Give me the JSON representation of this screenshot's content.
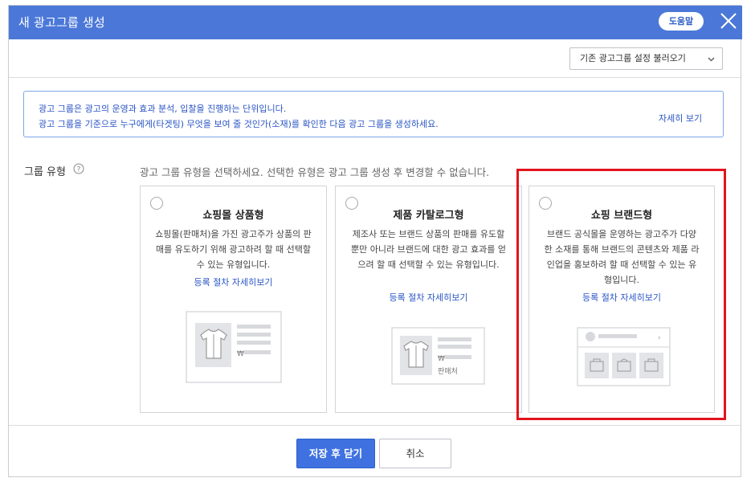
{
  "dialog": {
    "title": "새 광고그룹 생성",
    "help_label": "도움말"
  },
  "toolbar": {
    "load_settings_label": "기존 광고그룹 설정 불러오기"
  },
  "info": {
    "line1": "광고 그룹은 광고의 운영과 효과 분석, 입찰을 진행하는 단위입니다.",
    "line2": "광고 그룹을 기준으로 누구에게(타겟팅) 무엇을 보여 줄 것인가(소재)를 확인한 다음 광고 그룹을 생성하세요.",
    "detail_link": "자세히 보기"
  },
  "group_type": {
    "label": "그룹 유형",
    "description": "광고 그룹 유형을 선택하세요. 선택한 유형은 광고 그룹 생성 후 변경할 수 없습니다.",
    "cards": [
      {
        "title": "쇼핑몰 상품형",
        "description": "쇼핑몰(판매처)을 가진 광고주가 상품의 판매를 유도하기 위해 광고하려 할 때 선택할 수 있는 유형입니다.",
        "link": "등록 절차 자세히보기",
        "illus_price": "₩"
      },
      {
        "title": "제품 카탈로그형",
        "description": "제조사 또는 브랜드 상품의 판매를 유도할 뿐만 아니라 브랜드에 대한 광고 효과를 얻으려 할 때 선택할 수 있는 유형입니다.",
        "link": "등록 절차 자세히보기",
        "illus_price": "₩",
        "illus_seller": "판매처"
      },
      {
        "title": "쇼핑 브랜드형",
        "description": "브랜드 공식몰을 운영하는 광고주가 다양한 소재를 통해 브랜드의 콘텐츠와 제품 라인업을 홍보하려 할 때 선택할 수 있는 유형입니다.",
        "link": "등록 절차 자세히보기"
      }
    ]
  },
  "footer": {
    "save_close_label": "저장 후 닫기",
    "cancel_label": "취소"
  },
  "colors": {
    "title_bar": "#4b78d8",
    "link_blue": "#2a55c4",
    "primary_button": "#3f72e0",
    "highlight_red": "#e1141e"
  }
}
